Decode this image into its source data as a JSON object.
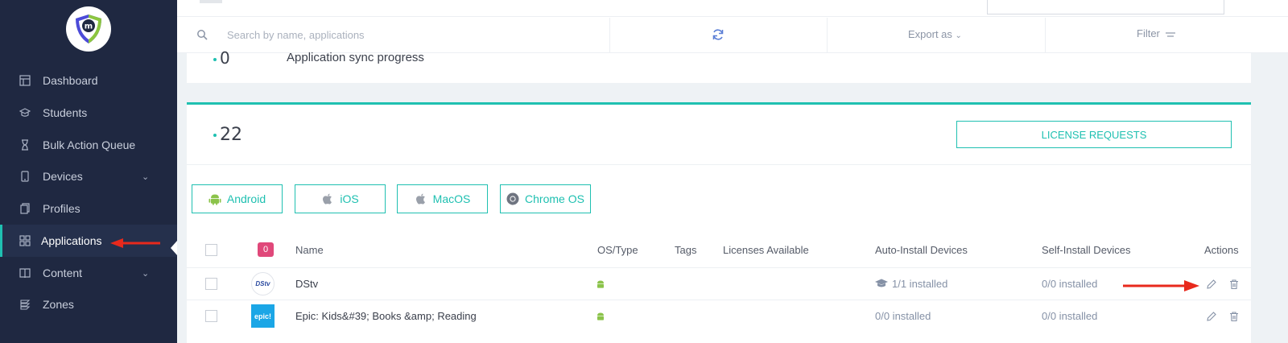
{
  "sidebar": {
    "items": [
      {
        "label": "Dashboard",
        "icon": "dashboard-icon"
      },
      {
        "label": "Students",
        "icon": "students-icon"
      },
      {
        "label": "Bulk Action Queue",
        "icon": "hourglass-icon"
      },
      {
        "label": "Devices",
        "icon": "device-icon",
        "expandable": true
      },
      {
        "label": "Profiles",
        "icon": "profiles-icon"
      },
      {
        "label": "Applications",
        "icon": "applications-icon",
        "active": true
      },
      {
        "label": "Content",
        "icon": "book-icon",
        "expandable": true
      },
      {
        "label": "Zones",
        "icon": "zones-icon"
      }
    ]
  },
  "toolbar": {
    "search_placeholder": "Search by name, applications",
    "export_label": "Export as",
    "filter_label": "Filter"
  },
  "sync": {
    "count": "0",
    "label": "Application sync progress"
  },
  "summary": {
    "total": "22",
    "license_requests_label": "LICENSE REQUESTS"
  },
  "os_filters": [
    {
      "label": "Android",
      "icon": "android-icon"
    },
    {
      "label": "iOS",
      "icon": "apple-icon"
    },
    {
      "label": "MacOS",
      "icon": "apple-icon"
    },
    {
      "label": "Chrome OS",
      "icon": "chrome-icon"
    }
  ],
  "table": {
    "selected_count": "0",
    "headers": {
      "name": "Name",
      "os_type": "OS/Type",
      "tags": "Tags",
      "licenses": "Licenses Available",
      "auto_install": "Auto-Install Devices",
      "self_install": "Self-Install Devices",
      "actions": "Actions"
    },
    "rows": [
      {
        "logo_text": "DStv",
        "name": "DStv",
        "os": "android",
        "auto_install": "1/1 installed",
        "self_install": "0/0 installed"
      },
      {
        "logo_text": "epic!",
        "name": "Epic: Kids&#39; Books &amp; Reading",
        "os": "android",
        "auto_install": "0/0 installed",
        "self_install": "0/0 installed"
      }
    ]
  },
  "colors": {
    "sidebar_bg": "#1f2841",
    "accent": "#1fc0b1",
    "badge": "#e0487a",
    "annotation_arrow": "#e8291c",
    "android": "#8bc34a"
  }
}
